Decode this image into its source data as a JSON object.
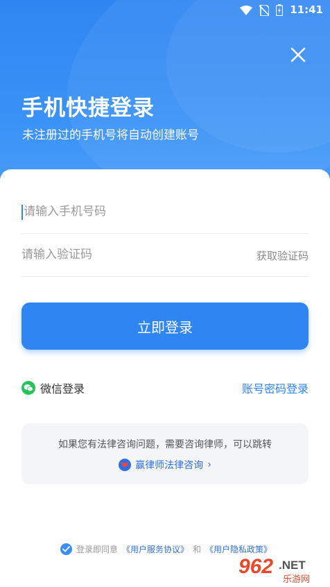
{
  "status_bar": {
    "time": "11:41"
  },
  "header": {
    "title": "手机快捷登录",
    "subtitle": "未注册过的手机号将自动创建账号"
  },
  "form": {
    "phone_placeholder": "请输入手机号码",
    "code_placeholder": "请输入验证码",
    "get_code_label": "获取验证码",
    "login_button_label": "立即登录"
  },
  "alt_login": {
    "wechat_label": "微信登录",
    "password_login_label": "账号密码登录"
  },
  "promo": {
    "text": "如果您有法律咨询问题，需要咨询律师，可以跳转",
    "link_label": "赢律师法律咨询",
    "link_arrow": "›"
  },
  "agreement": {
    "prefix": "登录即同意",
    "service_link": "《用户服务协议》",
    "and": "和",
    "privacy_link": "《用户隐私政策》"
  },
  "watermark": {
    "main": "962",
    "suffix": ".NET",
    "sub": "乐游网"
  },
  "colors": {
    "primary": "#2f86f2",
    "wechat": "#24c45a",
    "link": "#2f6fe0"
  }
}
